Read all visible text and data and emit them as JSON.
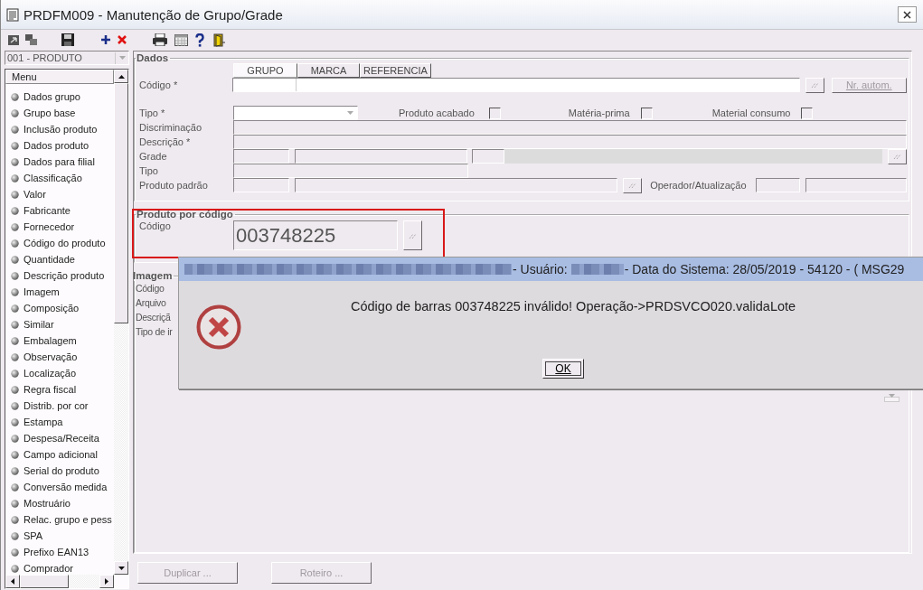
{
  "window": {
    "title": "PRDFM009 - Manutenção de Grupo/Grade"
  },
  "sidebar": {
    "selector": "001 - PRODUTO",
    "menu_header": "Menu",
    "items": [
      {
        "label": "Dados grupo"
      },
      {
        "label": "Grupo base"
      },
      {
        "label": "Inclusão produto"
      },
      {
        "label": "Dados produto"
      },
      {
        "label": "Dados para filial"
      },
      {
        "label": "Classificação"
      },
      {
        "label": "Valor"
      },
      {
        "label": "Fabricante"
      },
      {
        "label": "Fornecedor"
      },
      {
        "label": "Código do produto"
      },
      {
        "label": "Quantidade"
      },
      {
        "label": "Descrição produto"
      },
      {
        "label": "Imagem"
      },
      {
        "label": "Composição"
      },
      {
        "label": "Similar"
      },
      {
        "label": "Embalagem"
      },
      {
        "label": "Observação"
      },
      {
        "label": "Localização"
      },
      {
        "label": "Regra fiscal"
      },
      {
        "label": "Distrib. por cor"
      },
      {
        "label": "Estampa"
      },
      {
        "label": "Despesa/Receita"
      },
      {
        "label": "Campo adicional"
      },
      {
        "label": "Serial do produto"
      },
      {
        "label": "Conversão medida"
      },
      {
        "label": "Mostruário"
      },
      {
        "label": "Relac. grupo e pess"
      },
      {
        "label": "SPA"
      },
      {
        "label": "Prefixo EAN13"
      },
      {
        "label": "Comprador"
      }
    ]
  },
  "dados": {
    "title": "Dados",
    "code_tabs": [
      {
        "label": "GRUPO",
        "selected": true
      },
      {
        "label": "MARCA",
        "selected": false
      },
      {
        "label": "REFERENCIA",
        "selected": false
      }
    ],
    "codigo_label": "Código *",
    "auto_button": {
      "label": "Nr. autom.",
      "disabled": true
    },
    "tipo_label": "Tipo *",
    "checks": [
      {
        "label": "Produto acabado",
        "checked": false
      },
      {
        "label": "Matéria-prima",
        "checked": false
      },
      {
        "label": "Material consumo",
        "checked": false
      }
    ],
    "discriminacao_label": "Discriminação",
    "descricao_label": "Descrição *",
    "grade_label": "Grade",
    "tipo2_label": "Tipo",
    "produto_padrao_label": "Produto padrão",
    "operador_label": "Operador/Atualização"
  },
  "produto_por_codigo": {
    "title": "Produto por código",
    "label": "Código",
    "value": "003748225",
    "highlighted": true
  },
  "imagem": {
    "title": "Imagem",
    "labels": [
      "Código",
      "Arquivo",
      "Descriçã",
      "Tipo de ir"
    ]
  },
  "buttons": [
    {
      "label": "Duplicar ...",
      "disabled": true
    },
    {
      "label": "Roteiro ...",
      "disabled": true
    }
  ],
  "dialog": {
    "title_segments": [
      "- Usuário:",
      "- Data do Sistema: 28/05/2019 - 54120 - ( MSG29"
    ],
    "message": "Código de barras 003748225 inválido! Operação->PRDSVCO020.validaLote",
    "ok": "OK"
  }
}
